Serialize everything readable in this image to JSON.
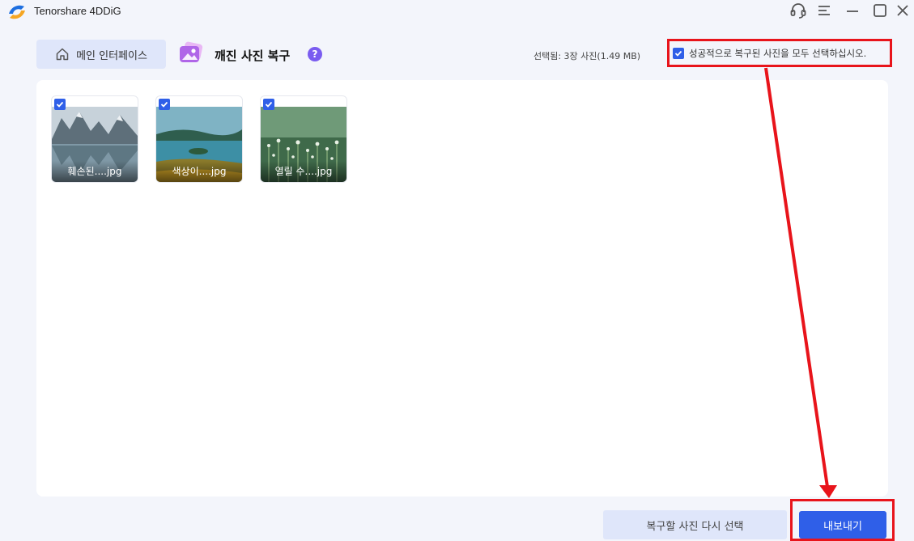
{
  "window": {
    "title": "Tenorshare 4DDiG",
    "icons": [
      "headset-icon",
      "menu-icon",
      "minimize-icon",
      "maximize-icon",
      "close-icon"
    ]
  },
  "header": {
    "home_label": "메인 인터페이스",
    "page_title": "깨진 사진 복구",
    "help_label": "?",
    "selected_info": "선택됨: 3장 사진(1.49 MB)",
    "select_all_label": "성공적으로 복구된 사진을 모두 선택하십시오.",
    "select_all_checked": true
  },
  "photos": [
    {
      "name": "훼손된....jpg",
      "checked": true
    },
    {
      "name": "색상이....jpg",
      "checked": true
    },
    {
      "name": "열릴 수....jpg",
      "checked": true
    }
  ],
  "footer": {
    "reselect_label": "복구할 사진 다시 선택",
    "export_label": "내보내기"
  },
  "colors": {
    "accent": "#2f5fe8",
    "highlight_red": "#e8141b",
    "help_purple": "#7a5cf0",
    "soft_button": "#dfe6fa"
  }
}
